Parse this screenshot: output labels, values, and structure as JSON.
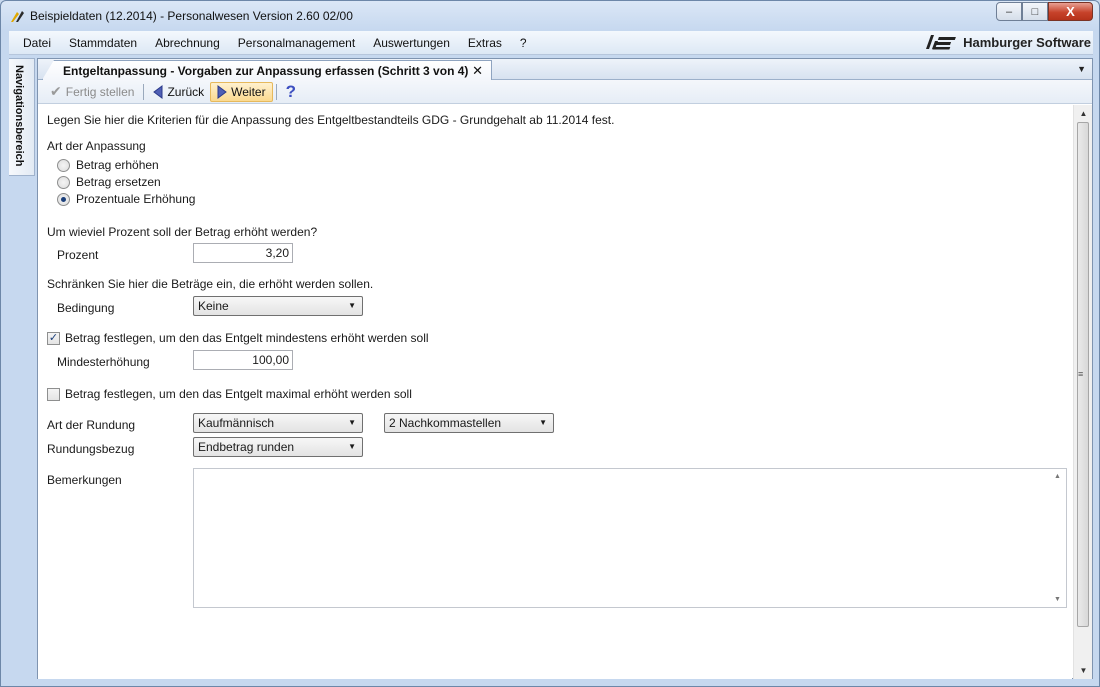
{
  "window": {
    "title": "Beispieldaten (12.2014) - Personalwesen Version 2.60 02/00",
    "minimize": "–",
    "maximize": "□",
    "close": "X"
  },
  "menu": {
    "items": [
      "Datei",
      "Stammdaten",
      "Abrechnung",
      "Personalmanagement",
      "Auswertungen",
      "Extras",
      "?"
    ],
    "brand": "Hamburger Software"
  },
  "navigation": {
    "label": "Navigationsbereich"
  },
  "tab": {
    "title": "Entgeltanpassung - Vorgaben zur Anpassung erfassen (Schritt 3 von 4)"
  },
  "toolbar": {
    "finish": "Fertig stellen",
    "back": "Zurück",
    "next": "Weiter"
  },
  "form": {
    "intro": "Legen Sie hier die Kriterien für die Anpassung des Entgeltbestandteils GDG - Grundgehalt ab 11.2014 fest.",
    "art_heading": "Art der Anpassung",
    "radios": [
      {
        "label": "Betrag erhöhen",
        "checked": false
      },
      {
        "label": "Betrag ersetzen",
        "checked": false
      },
      {
        "label": "Prozentuale Erhöhung",
        "checked": true
      }
    ],
    "percent_question": "Um wieviel Prozent soll der Betrag erhöht werden?",
    "percent_label": "Prozent",
    "percent_value": "3,20",
    "restrict_text": "Schränken Sie hier die Beträge ein, die erhöht werden sollen.",
    "condition_label": "Bedingung",
    "condition_value": "Keine",
    "min_check_label": "Betrag festlegen, um den das Entgelt mindestens erhöht werden soll",
    "min_checked": true,
    "min_label": "Mindesterhöhung",
    "min_value": "100,00",
    "max_check_label": "Betrag festlegen, um den das Entgelt maximal erhöht werden soll",
    "max_checked": false,
    "rounding_label": "Art der Rundung",
    "rounding_value": "Kaufmännisch",
    "decimals_value": "2 Nachkommastellen",
    "rounding_ref_label": "Rundungsbezug",
    "rounding_ref_value": "Endbetrag runden",
    "remarks_label": "Bemerkungen",
    "remarks_value": ""
  },
  "colors": {
    "accent": "#1b3f7a",
    "close_red": "#c7432b",
    "hover_orange": "#fbd98f"
  }
}
